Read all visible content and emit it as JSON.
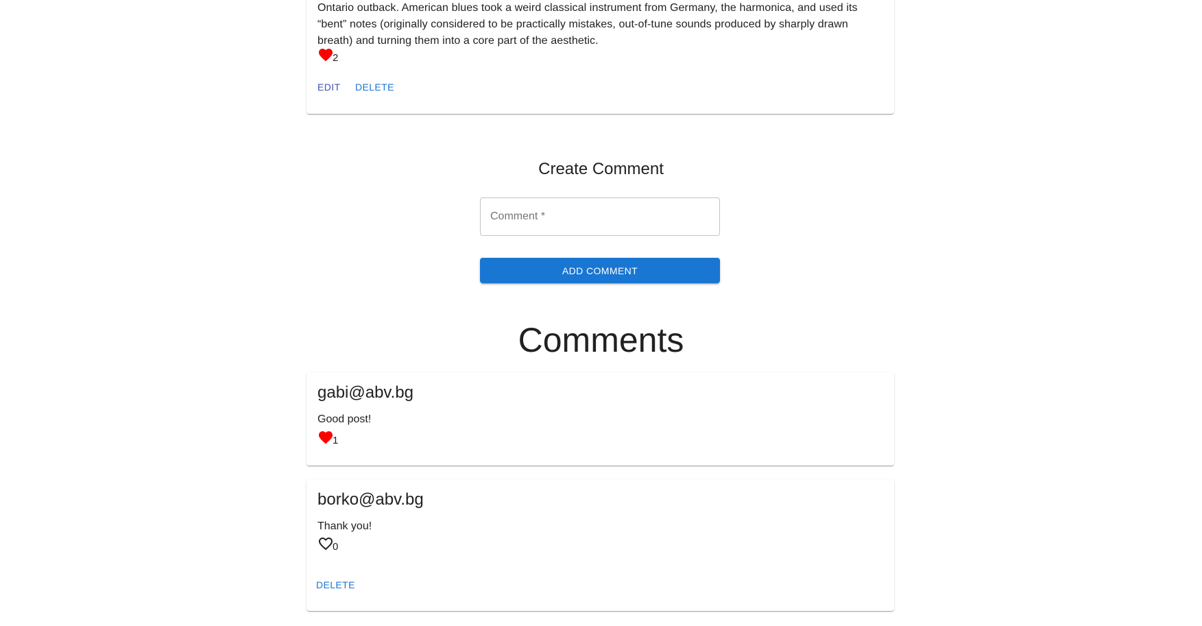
{
  "post": {
    "body": "Ontario outback. American blues took a weird classical instrument from Germany, the harmonica, and used its “bent” notes (originally considered to be practically mistakes, out-of-tune sounds produced by sharply drawn breath) and turning them into a core part of the aesthetic.",
    "likes": "2",
    "edit_label": "Edit",
    "delete_label": "Delete"
  },
  "create_comment": {
    "title": "Create Comment",
    "placeholder": "Comment *",
    "button_label": "Add Comment"
  },
  "comments_heading": "Comments",
  "comments": [
    {
      "author": "gabi@abv.bg",
      "text": "Good post!",
      "likes": "1",
      "liked": true
    },
    {
      "author": "borko@abv.bg",
      "text": "Thank you!",
      "likes": "0",
      "liked": false,
      "delete_label": "Delete"
    }
  ],
  "colors": {
    "heart_filled": "#ff0000",
    "primary": "#1976d2",
    "edit": "#3f51b5"
  }
}
